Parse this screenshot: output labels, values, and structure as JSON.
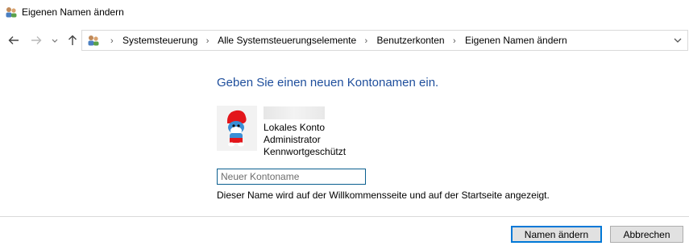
{
  "window": {
    "title": "Eigenen Namen ändern"
  },
  "navigation": {
    "back_icon": "arrow-left-icon",
    "forward_icon": "arrow-right-icon",
    "recent_icon": "chevron-down-icon",
    "up_icon": "arrow-up-icon",
    "breadcrumbs": [
      "Systemsteuerung",
      "Alle Systemsteuerungselemente",
      "Benutzerkonten",
      "Eigenen Namen ändern"
    ]
  },
  "main": {
    "heading": "Geben Sie einen neuen Kontonamen ein.",
    "account": {
      "type": "Lokales Konto",
      "role": "Administrator",
      "protection": "Kennwortgeschützt"
    },
    "new_name": {
      "value": "",
      "placeholder": "Neuer Kontoname"
    },
    "hint": "Dieser Name wird auf der Willkommensseite und auf der Startseite angezeigt."
  },
  "buttons": {
    "rename": "Namen ändern",
    "cancel": "Abbrechen"
  },
  "colors": {
    "heading": "#1e4e9c",
    "accent": "#0078d7",
    "field_border": "#0a5f8f"
  }
}
